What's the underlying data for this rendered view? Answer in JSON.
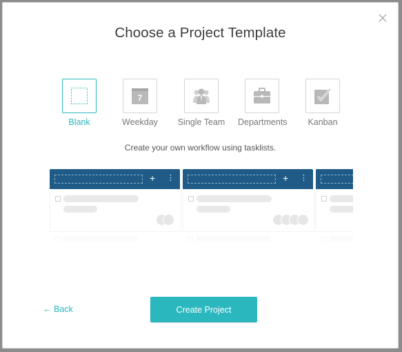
{
  "dialog": {
    "title": "Choose a Project Template",
    "close_icon": "close-icon"
  },
  "templates": [
    {
      "label": "Blank",
      "icon": "blank-template-icon",
      "selected": true
    },
    {
      "label": "Weekday",
      "icon": "calendar-icon",
      "badge": "7",
      "selected": false
    },
    {
      "label": "Single Team",
      "icon": "team-icon",
      "selected": false
    },
    {
      "label": "Departments",
      "icon": "briefcase-icon",
      "selected": false
    },
    {
      "label": "Kanban",
      "icon": "kanban-check-icon",
      "selected": false
    }
  ],
  "description": "Create your own workflow using tasklists.",
  "preview": {
    "column_add": "+",
    "column_more": "⋮"
  },
  "footer": {
    "back_label": "← Back",
    "create_label": "Create Project"
  },
  "colors": {
    "accent": "#2bb7bf",
    "column_header": "#1f5b86"
  }
}
